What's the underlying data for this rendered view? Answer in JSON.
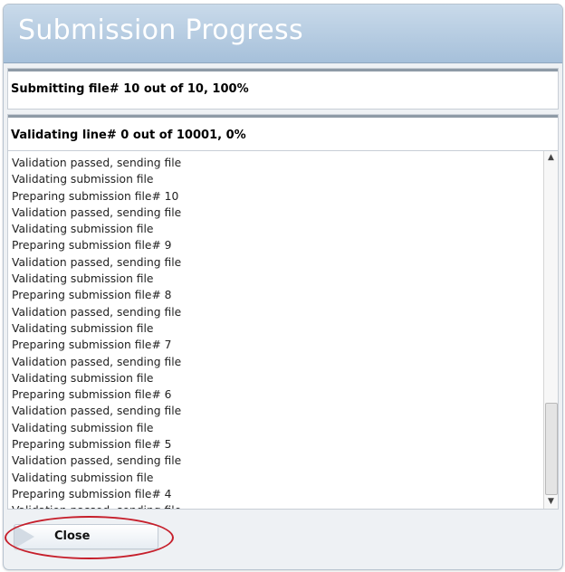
{
  "dialog": {
    "title": "Submission Progress",
    "close_label": "Close"
  },
  "status": {
    "submitting": "Submitting file# 10 out of 10, 100%",
    "validating": "Validating line# 0 out of 10001, 0%"
  },
  "log": {
    "lines": [
      "Validation passed, sending file",
      "Validating submission file",
      "Preparing submission file# 10",
      "Validation passed, sending file",
      "Validating submission file",
      "Preparing submission file# 9",
      "Validation passed, sending file",
      "Validating submission file",
      "Preparing submission file# 8",
      "Validation passed, sending file",
      "Validating submission file",
      "Preparing submission file# 7",
      "Validation passed, sending file",
      "Validating submission file",
      "Preparing submission file# 6",
      "Validation passed, sending file",
      "Validating submission file",
      "Preparing submission file# 5",
      "Validation passed, sending file",
      "Validating submission file",
      "Preparing submission file# 4",
      "Validation passed, sending file"
    ]
  },
  "scrollbar": {
    "up_icon": "▲",
    "down_icon": "▼"
  },
  "colors": {
    "title_bar": "#a6c0da",
    "highlight": "#c61f2b"
  }
}
